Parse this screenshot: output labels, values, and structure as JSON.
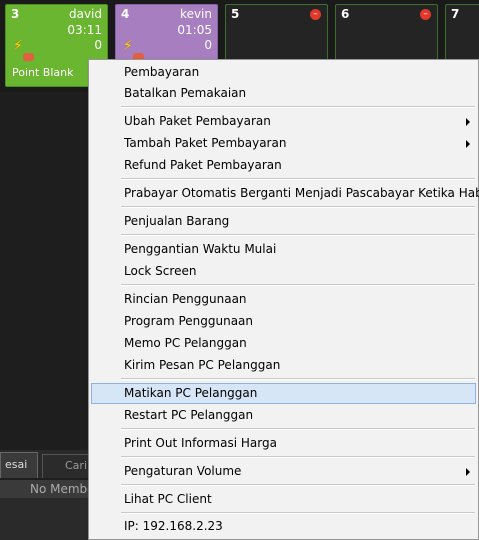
{
  "tiles": [
    {
      "number": "3",
      "user": "david",
      "time": "03:11",
      "count": "0",
      "game": "Point Blank"
    },
    {
      "number": "4",
      "user": "kevin",
      "time": "01:05",
      "count": "0"
    },
    {
      "number": "5"
    },
    {
      "number": "6"
    },
    {
      "number": "7"
    }
  ],
  "bottom": {
    "tab1": "esai",
    "tab2": "Cari",
    "status": "No Membe"
  },
  "menu": {
    "items": [
      "Pembayaran",
      "Batalkan Pemakaian",
      "Ubah Paket Pembayaran",
      "Tambah Paket Pembayaran",
      "Refund Paket Pembayaran",
      "Prabayar Otomatis Berganti Menjadi Pascabayar Ketika Habis",
      "Penjualan Barang",
      "Penggantian Waktu Mulai",
      "Lock Screen",
      "Rincian Penggunaan",
      "Program Penggunaan",
      "Memo PC Pelanggan",
      "Kirim Pesan PC Pelanggan",
      "Matikan PC Pelanggan",
      "Restart PC Pelanggan",
      "Print Out Informasi Harga",
      "Pengaturan Volume",
      "Lihat PC Client",
      "IP: 192.168.2.23"
    ],
    "highlighted": "Matikan PC Pelanggan",
    "submenu_items": [
      "Ubah Paket Pembayaran",
      "Tambah Paket Pembayaran",
      "Pengaturan Volume"
    ]
  },
  "colors": {
    "tile_active": "#6ab630",
    "tile_kevin": "#a77fc0",
    "tile_idle": "#242424",
    "menu_bg": "#f2f2f2",
    "highlight": "#d7e6f7"
  },
  "icons": [
    "bolt-icon",
    "car-icon",
    "stop-icon",
    "submenu-arrow-icon"
  ]
}
